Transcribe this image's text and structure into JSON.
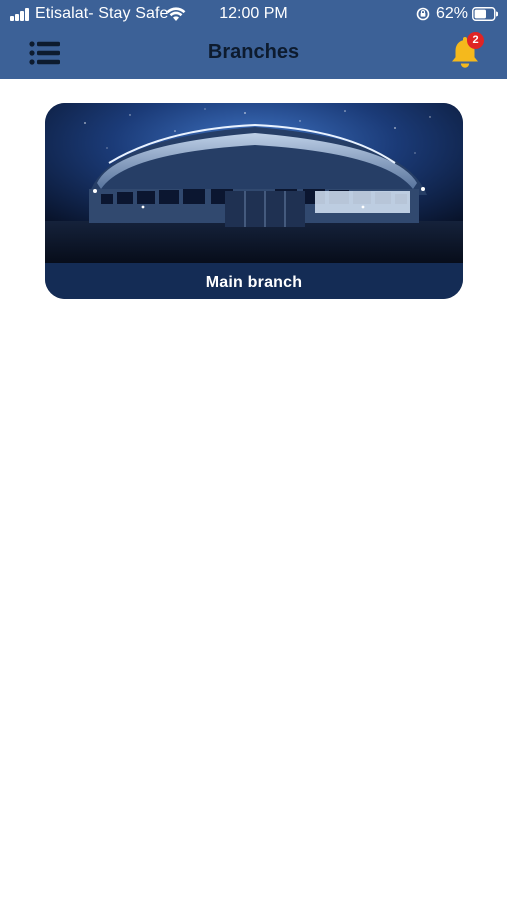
{
  "status_bar": {
    "carrier": "Etisalat- Stay Safe",
    "time": "12:00 PM",
    "battery_percent": "62%",
    "battery_level": 0.62,
    "icons": [
      "signal-icon",
      "wifi-icon",
      "orientation-lock-icon",
      "battery-icon"
    ]
  },
  "header": {
    "title": "Branches",
    "menu_icon": "list-menu-icon",
    "notification_icon": "bell-icon",
    "notification_count": "2",
    "background_color": "#3c6197",
    "bell_color": "#f5b91c"
  },
  "branches": [
    {
      "name": "Main branch",
      "image": "stadium-night-photo"
    }
  ]
}
